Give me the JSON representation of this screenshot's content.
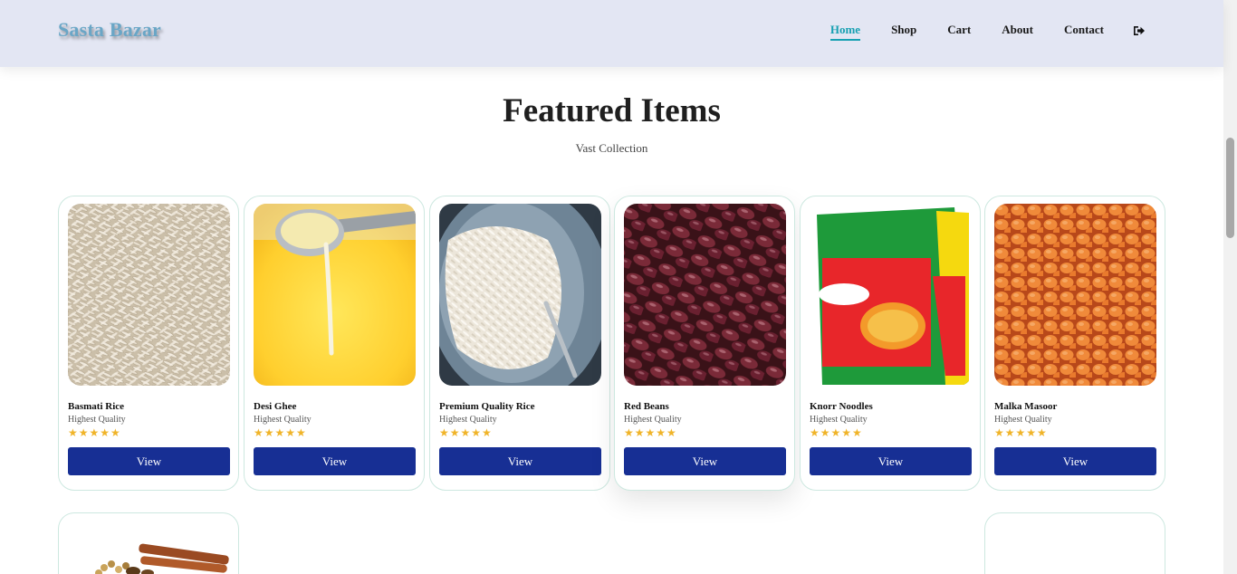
{
  "header": {
    "brand": "Sasta Bazar",
    "nav": [
      {
        "label": "Home",
        "active": true
      },
      {
        "label": "Shop",
        "active": false
      },
      {
        "label": "Cart",
        "active": false
      },
      {
        "label": "About",
        "active": false
      },
      {
        "label": "Contact",
        "active": false
      }
    ],
    "logout_icon": "sign-out-icon"
  },
  "section": {
    "title": "Featured Items",
    "subtitle": "Vast Collection"
  },
  "products": [
    {
      "name": "Basmati Rice",
      "quality": "Highest Quality",
      "rating": 5,
      "stars": "★★★★★",
      "button": "View",
      "image": "basmati-rice-grains"
    },
    {
      "name": "Desi Ghee",
      "quality": "Highest Quality",
      "rating": 5,
      "stars": "★★★★★",
      "button": "View",
      "image": "ghee-ladle"
    },
    {
      "name": "Premium Quality Rice",
      "quality": "Highest Quality",
      "rating": 5,
      "stars": "★★★★★",
      "button": "View",
      "image": "cooked-rice-bowl"
    },
    {
      "name": "Red Beans",
      "quality": "Highest Quality",
      "rating": 5,
      "stars": "★★★★★",
      "button": "View",
      "image": "red-kidney-beans"
    },
    {
      "name": "Knorr Noodles",
      "quality": "Highest Quality",
      "rating": 5,
      "stars": "★★★★★",
      "button": "View",
      "image": "knorr-noodles-pack"
    },
    {
      "name": "Malka Masoor",
      "quality": "Highest Quality",
      "rating": 5,
      "stars": "★★★★★",
      "button": "View",
      "image": "red-lentils"
    }
  ],
  "second_row": [
    {
      "image": "spices"
    },
    {
      "image": "blank"
    }
  ],
  "colors": {
    "header_bg": "#e3e6f3",
    "brand": "#6aa6c6",
    "active_nav": "#17a0b2",
    "button": "#172f94",
    "star": "#f0b429",
    "card_border": "#cde8e0"
  }
}
